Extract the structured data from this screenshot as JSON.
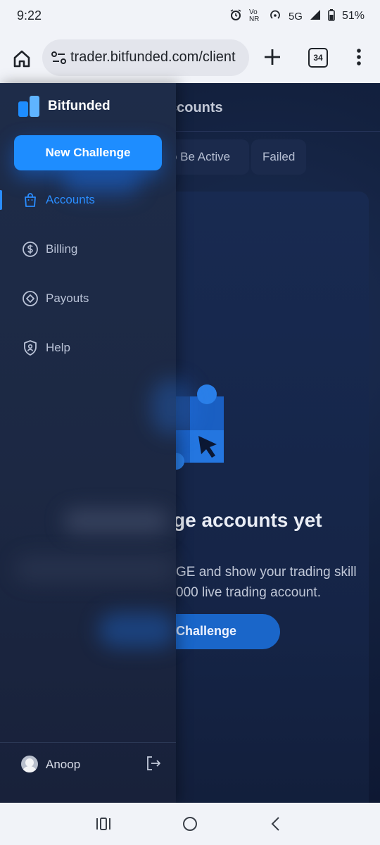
{
  "status_bar": {
    "time": "9:22",
    "network": "5G",
    "volte": "Vo NR",
    "battery": "51%"
  },
  "browser": {
    "url": "trader.bitfunded.com/client",
    "tab_count": "34"
  },
  "background_page": {
    "title_fragment": "ccounts",
    "filters": [
      "o Be Active",
      "Failed"
    ],
    "empty_title": "ge accounts yet",
    "empty_desc_line1": "GE and show your trading skill",
    "empty_desc_line2": "000 live trading account.",
    "cta_fragment": "Challenge"
  },
  "sidebar": {
    "brand": "Bitfunded",
    "new_challenge": "New Challenge",
    "items": [
      {
        "label": "Accounts",
        "icon": "bag-icon",
        "active": true
      },
      {
        "label": "Billing",
        "icon": "dollar-circle-icon",
        "active": false
      },
      {
        "label": "Payouts",
        "icon": "diamond-circle-icon",
        "active": false
      },
      {
        "label": "Help",
        "icon": "help-shield-icon",
        "active": false
      }
    ],
    "user": "Anoop"
  },
  "colors": {
    "accent": "#1e8dff",
    "sidebar_bg": "#1e2c49",
    "page_bg": "#0f1a33"
  }
}
